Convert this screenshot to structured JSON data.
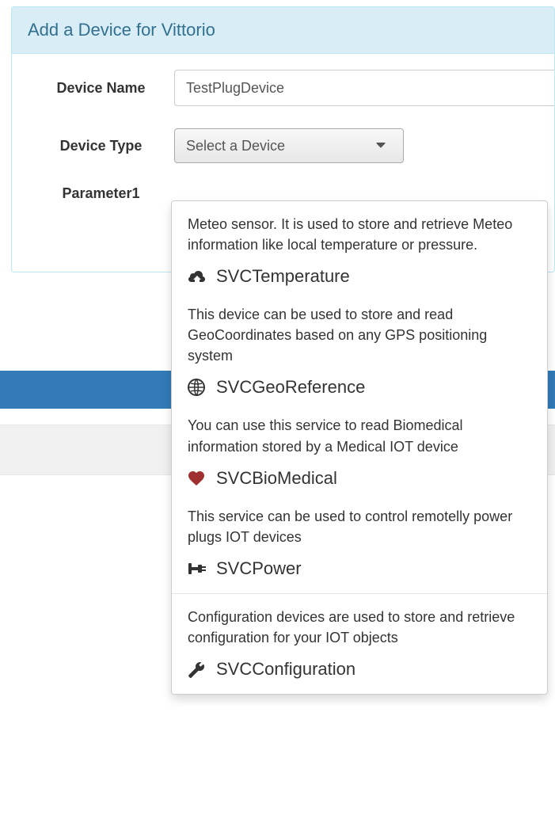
{
  "panel": {
    "title": "Add a Device for Vittorio"
  },
  "form": {
    "device_name_label": "Device Name",
    "device_name_value": "TestPlugDevice",
    "device_type_label": "Device Type",
    "device_type_placeholder": "Select a Device",
    "parameter1_label": "Parameter1"
  },
  "dropdown": {
    "items": [
      {
        "desc": "Meteo sensor. It is used to store and retrieve Meteo information like local temperature or pressure.",
        "title": "SVCTemperature",
        "icon": "cloud-download-icon"
      },
      {
        "desc": "This device can be used to store and read GeoCoordinates based on any GPS positioning system",
        "title": "SVCGeoReference",
        "icon": "globe-icon"
      },
      {
        "desc": "You can use this service to read Biomedical information stored by a Medical IOT device",
        "title": "SVCBioMedical",
        "icon": "heart-icon"
      },
      {
        "desc": "This service can be used to control remotelly power plugs IOT devices",
        "title": "SVCPower",
        "icon": "plug-icon"
      },
      {
        "desc": "Configuration devices are used to store and retrieve configuration for your IOT objects",
        "title": "SVCConfiguration",
        "icon": "wrench-icon"
      }
    ]
  }
}
